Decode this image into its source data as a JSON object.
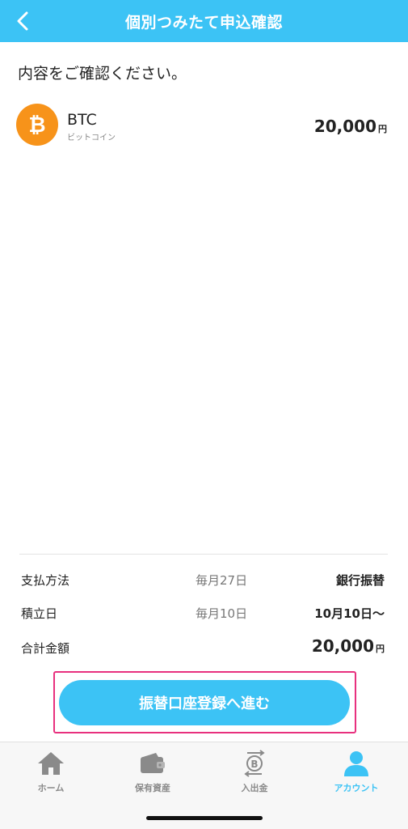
{
  "header": {
    "title": "個別つみたて申込確認"
  },
  "intro": {
    "text": "内容をご確認ください。"
  },
  "coin": {
    "symbol": "BTC",
    "name": "ビットコイン",
    "amount": "20,000",
    "unit": "円",
    "icon_glyph": "₿",
    "icon_color": "#f7931a"
  },
  "summary": {
    "payment": {
      "label": "支払方法",
      "sub": "毎月27日",
      "value": "銀行振替"
    },
    "accumulation": {
      "label": "積立日",
      "sub": "毎月10日",
      "value": "10月10日〜"
    },
    "total": {
      "label": "合計金額",
      "value": "20,000",
      "unit": "円"
    }
  },
  "cta": {
    "label": "振替口座登録へ進む"
  },
  "tabs": [
    {
      "label": "ホーム",
      "icon": "home-icon",
      "active": false
    },
    {
      "label": "保有資産",
      "icon": "wallet-icon",
      "active": false
    },
    {
      "label": "入出金",
      "icon": "deposit-withdraw-icon",
      "active": false
    },
    {
      "label": "アカウント",
      "icon": "account-icon",
      "active": true
    }
  ],
  "colors": {
    "accent": "#3cc3f5",
    "highlight": "#e8307e",
    "tab_inactive": "#8a8a8a"
  }
}
